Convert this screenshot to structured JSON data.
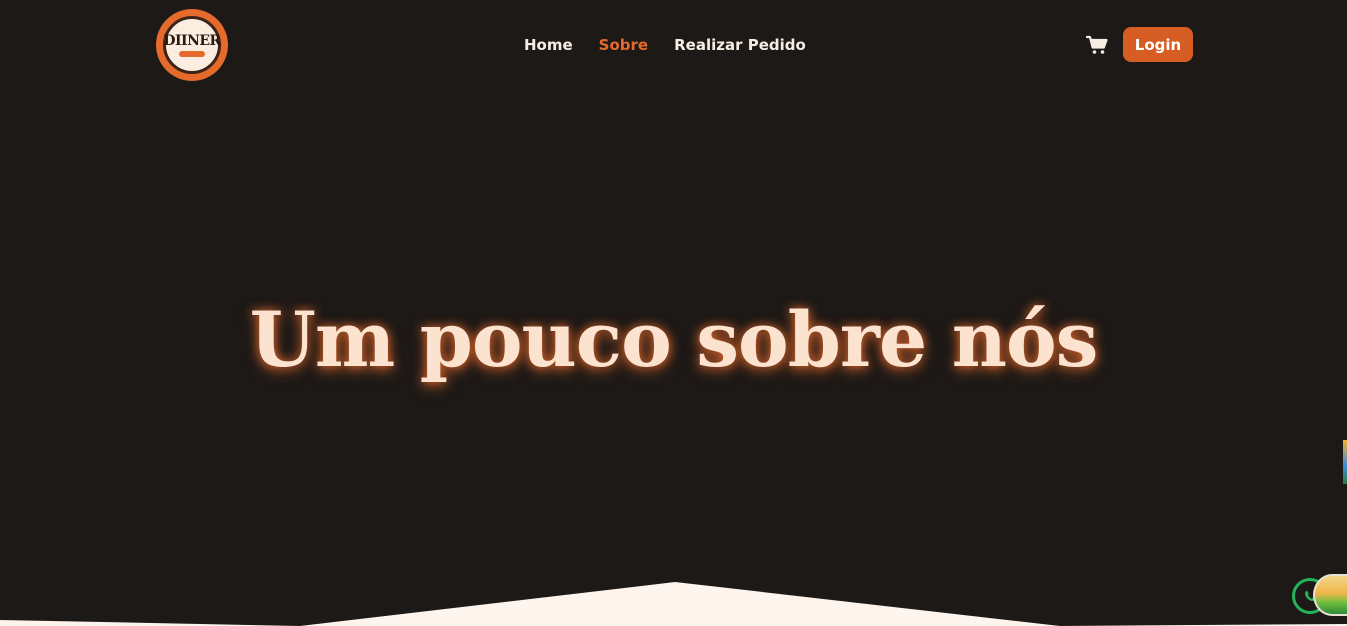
{
  "header": {
    "logo_text": "DIINER",
    "nav": [
      {
        "label": "Home",
        "active": false
      },
      {
        "label": "Sobre",
        "active": true
      },
      {
        "label": "Realizar Pedido",
        "active": false
      }
    ],
    "cart_icon": "cart-icon",
    "login_label": "Login"
  },
  "hero": {
    "title": "Um pouco sobre nós"
  },
  "colors": {
    "background": "#1d1917",
    "accent": "#e56a2b",
    "button": "#d65d24",
    "nav_text": "#f6ece1",
    "title_text": "#fbe3cf",
    "wave": "#fdf4ee"
  },
  "floating": {
    "whatsapp_icon": "whatsapp-icon"
  }
}
